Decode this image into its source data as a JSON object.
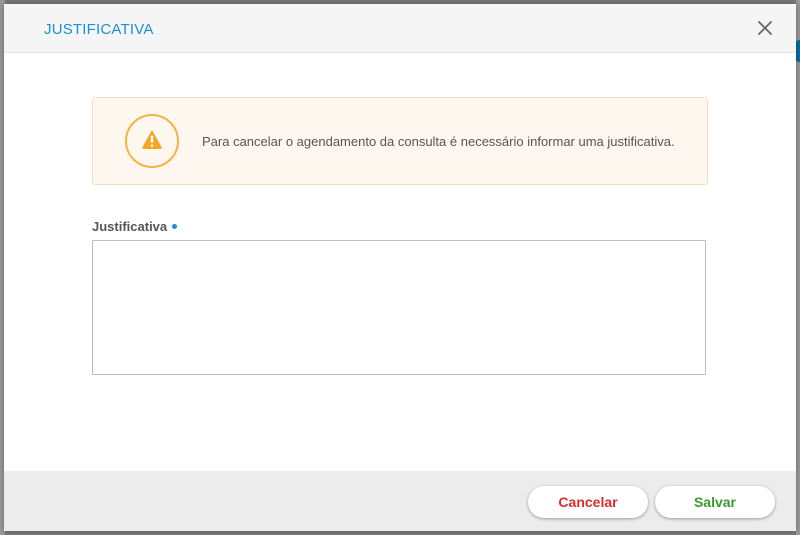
{
  "modal": {
    "title": "JUSTIFICATIVA",
    "close_icon": "close-icon"
  },
  "alert": {
    "icon": "warning-triangle-icon",
    "message": "Para cancelar o agendamento da consulta é necessário informar uma justificativa.",
    "accent_color": "#f5a623"
  },
  "form": {
    "label": "Justificativa",
    "required": true,
    "value": ""
  },
  "footer": {
    "cancel_label": "Cancelar",
    "save_label": "Salvar"
  },
  "colors": {
    "title": "#1a8fd8",
    "cancel": "#d32f2f",
    "save": "#3a9a2e",
    "required_dot": "#1a8fd8"
  }
}
